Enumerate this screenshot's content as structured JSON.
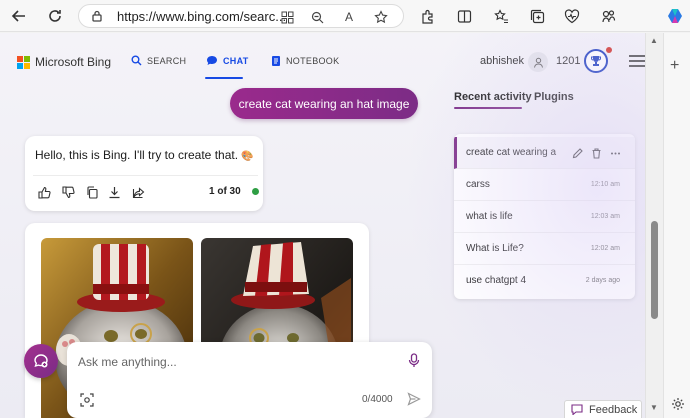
{
  "browser": {
    "url": "https://www.bing.com/searc...",
    "reader_label": "A"
  },
  "header": {
    "logo_text": "Microsoft Bing",
    "nav": [
      {
        "label": "SEARCH",
        "icon": "search-icon"
      },
      {
        "label": "CHAT",
        "icon": "chat-icon",
        "active": true
      },
      {
        "label": "NOTEBOOK",
        "icon": "notebook-icon"
      }
    ],
    "username": "abhishek",
    "points": "1201"
  },
  "chat": {
    "user_message": "create cat wearing an hat image",
    "bot_message": "Hello, this is Bing. I'll try to create that.",
    "bot_emoji": "🎨",
    "response_count": "1 of 30"
  },
  "input": {
    "placeholder": "Ask me anything...",
    "char_count": "0/4000"
  },
  "side_panel": {
    "tabs": [
      "Recent activity",
      "Plugins"
    ],
    "items": [
      {
        "title": "create cat wearing a",
        "date": ""
      },
      {
        "title": "carss",
        "date": "12:10 am"
      },
      {
        "title": "what is life",
        "date": "12:03 am"
      },
      {
        "title": "What is Life?",
        "date": "12:02 am"
      },
      {
        "title": "use chatgpt 4",
        "date": "2 days ago"
      }
    ]
  },
  "feedback_label": "Feedback",
  "colors": {
    "accent": "#7b2c86",
    "brand_blue": "#174ae4",
    "status_green": "#2e9e44"
  }
}
